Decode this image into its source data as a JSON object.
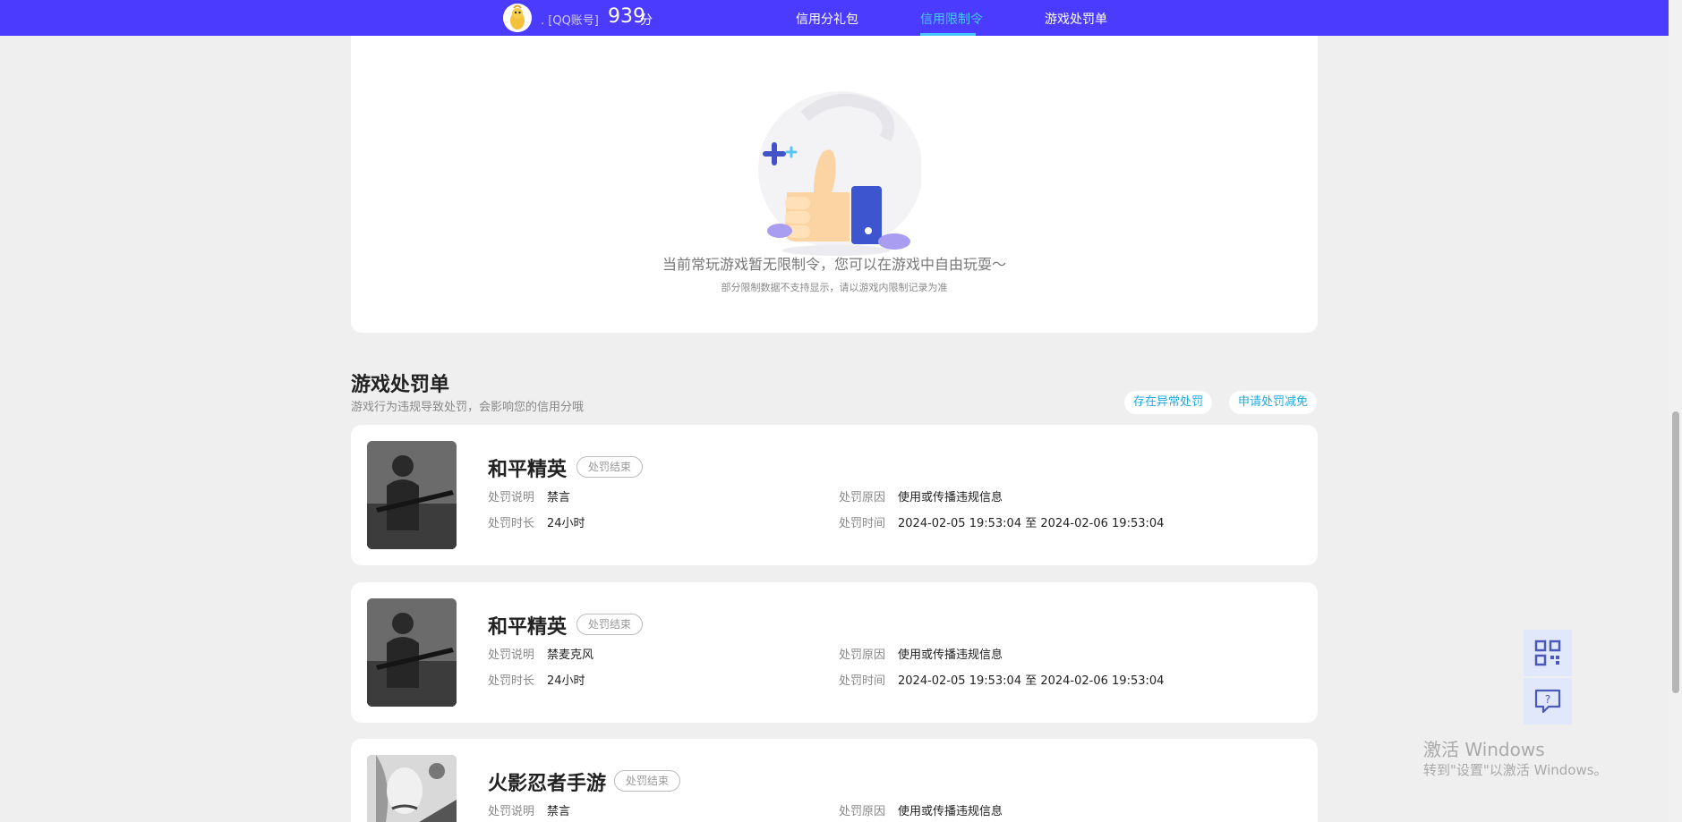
{
  "header": {
    "account_label": ". [QQ账号]",
    "score": "939",
    "score_unit": "分",
    "nav": [
      {
        "label": "信用分礼包"
      },
      {
        "label": "信用限制令"
      },
      {
        "label": "游戏处罚单"
      }
    ]
  },
  "empty_state": {
    "title": "当前常玩游戏暂无限制令，您可以在游戏中自由玩耍～",
    "subtitle": "部分限制数据不支持显示，请以游戏内限制记录为准"
  },
  "penalty_section": {
    "title": "游戏处罚单",
    "subtitle": "游戏行为违规导致处罚，会影响您的信用分哦",
    "actions": [
      "存在异常处罚",
      "申请处罚减免"
    ],
    "field_labels": {
      "desc": "处罚说明",
      "reason": "处罚原因",
      "duration": "处罚时长",
      "time": "处罚时间"
    },
    "records": [
      {
        "game": "和平精英",
        "status": "处罚结束",
        "desc": "禁言",
        "reason": "使用或传播违规信息",
        "duration": "24小时",
        "time": "2024-02-05 19:53:04 至 2024-02-06 19:53:04"
      },
      {
        "game": "和平精英",
        "status": "处罚结束",
        "desc": "禁麦克风",
        "reason": "使用或传播违规信息",
        "duration": "24小时",
        "time": "2024-02-05 19:53:04 至 2024-02-06 19:53:04"
      },
      {
        "game": "火影忍者手游",
        "status": "处罚结束",
        "desc": "禁言",
        "reason": "使用或传播违规信息"
      }
    ]
  },
  "watermark": {
    "line1": "激活 Windows",
    "line2": "转到\"设置\"以激活 Windows。"
  },
  "colors": {
    "nav_bg": "#4a3bff",
    "nav_active": "#47c8ff",
    "page_bg": "#efefef",
    "accent_link": "#1fa8e0"
  },
  "icons": [
    "qr-code-icon",
    "help-feedback-icon"
  ]
}
